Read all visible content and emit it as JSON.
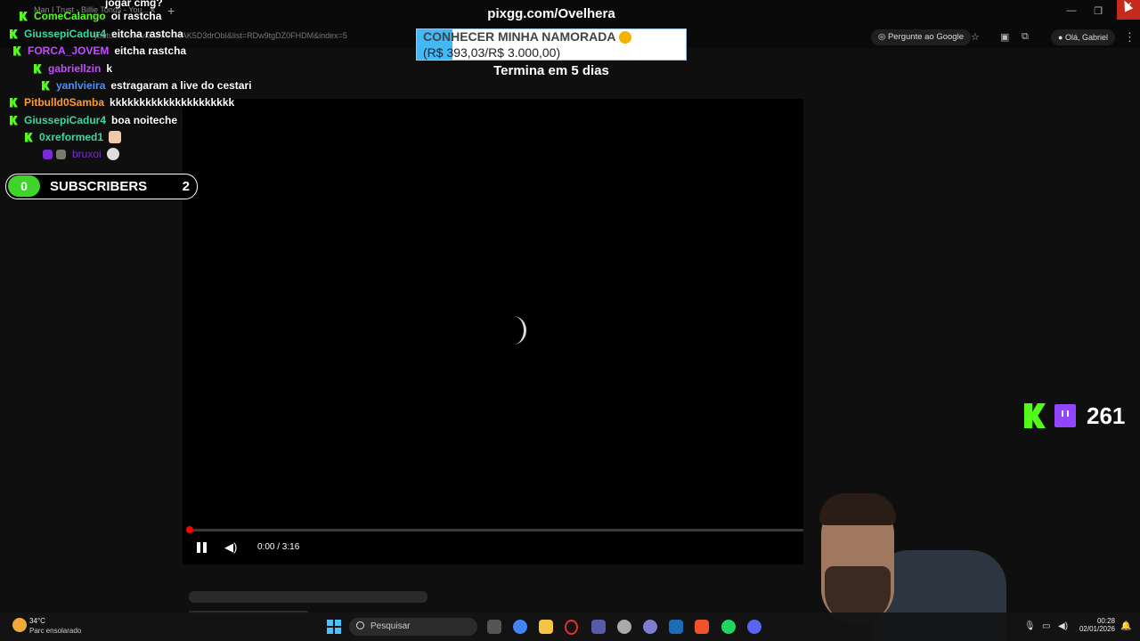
{
  "browser": {
    "tab_title": "Man I Trust - Billie Tongs - You...",
    "url": "youtube.com/watch?v=HAK5D3drObI&list=RDw9tgDZ0FHDM&index=5",
    "google_btn": "Pergunte ao Google",
    "profile": "Olá, Gabriel"
  },
  "overlay": {
    "pix_title": "pixgg.com/Ovelhera",
    "goal_title": "CONHECER MINHA NAMORADA",
    "goal_amount": "(R$ 393,03/R$ 3.000,00)",
    "goal_progress": 0.131,
    "ends_text": "Termina em 5 dias"
  },
  "chat": {
    "partial_top": "jogar cmg?",
    "messages": [
      {
        "user": "ComeCalango",
        "text": "oi rastcha",
        "color": "#53fc18"
      },
      {
        "user": "GiussepiCadur4",
        "text": "eitcha rastcha",
        "color": "#39d9a0"
      },
      {
        "user": "FORCA_JOVEM",
        "text": "eitcha rastcha",
        "color": "#c34cff"
      },
      {
        "user": "gabriellzin",
        "text": "k",
        "color": "#c34cff"
      },
      {
        "user": "yanlvieira",
        "text": "estragaram a live do cestari",
        "color": "#4f8ff7"
      },
      {
        "user": "Pitbulld0Samba",
        "text": "kkkkkkkkkkkkkkkkkkkkk",
        "color": "#ff9a2e"
      },
      {
        "user": "GiussepiCadur4",
        "text": "boa noiteche",
        "color": "#39d9a0"
      },
      {
        "user": "0xreformed1",
        "text": "",
        "color": "#39d9a0"
      },
      {
        "user": "bruxoi",
        "text": "",
        "color": "#7b2bd6"
      }
    ]
  },
  "subscribers": {
    "left": "0",
    "label": "SUBSCRIBERS",
    "count": "2"
  },
  "player": {
    "time": "0:00 / 3:16"
  },
  "viewers": {
    "count": "261"
  },
  "taskbar": {
    "temperature": "34°C",
    "weather": "Parc ensolarado",
    "search": "Pesquisar",
    "time": "00:28",
    "date": "02/01/2026"
  }
}
